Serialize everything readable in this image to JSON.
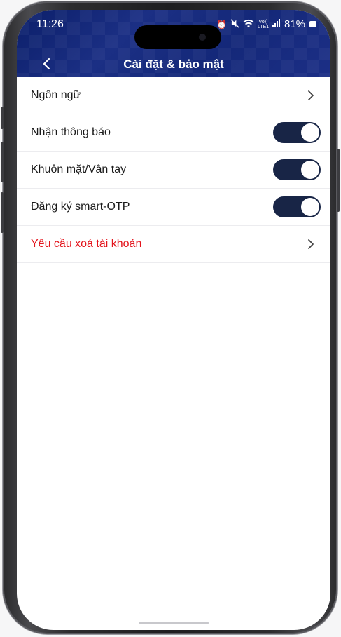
{
  "status_bar": {
    "time": "11:26",
    "icons": [
      "alarm-icon",
      "mute-icon",
      "wifi-icon",
      "volte-icon",
      "signal-icon"
    ],
    "volte_text": "Vo)) LTE1",
    "battery_percent": "81%"
  },
  "header": {
    "title": "Cài đặt & bảo mật",
    "back_icon": "chevron-left-icon",
    "background_color": "#1b2f84"
  },
  "settings": {
    "language": {
      "label": "Ngôn ngữ"
    },
    "notifications": {
      "label": "Nhận thông báo",
      "enabled": true
    },
    "biometric": {
      "label": "Khuôn mặt/Vân tay",
      "enabled": true
    },
    "smart_otp": {
      "label": "Đăng ký smart-OTP",
      "enabled": true
    },
    "delete_account": {
      "label": "Yêu cầu xoá tài khoản",
      "color": "#e3141c"
    }
  },
  "colors": {
    "toggle_on": "#182546",
    "danger": "#e3141c"
  }
}
